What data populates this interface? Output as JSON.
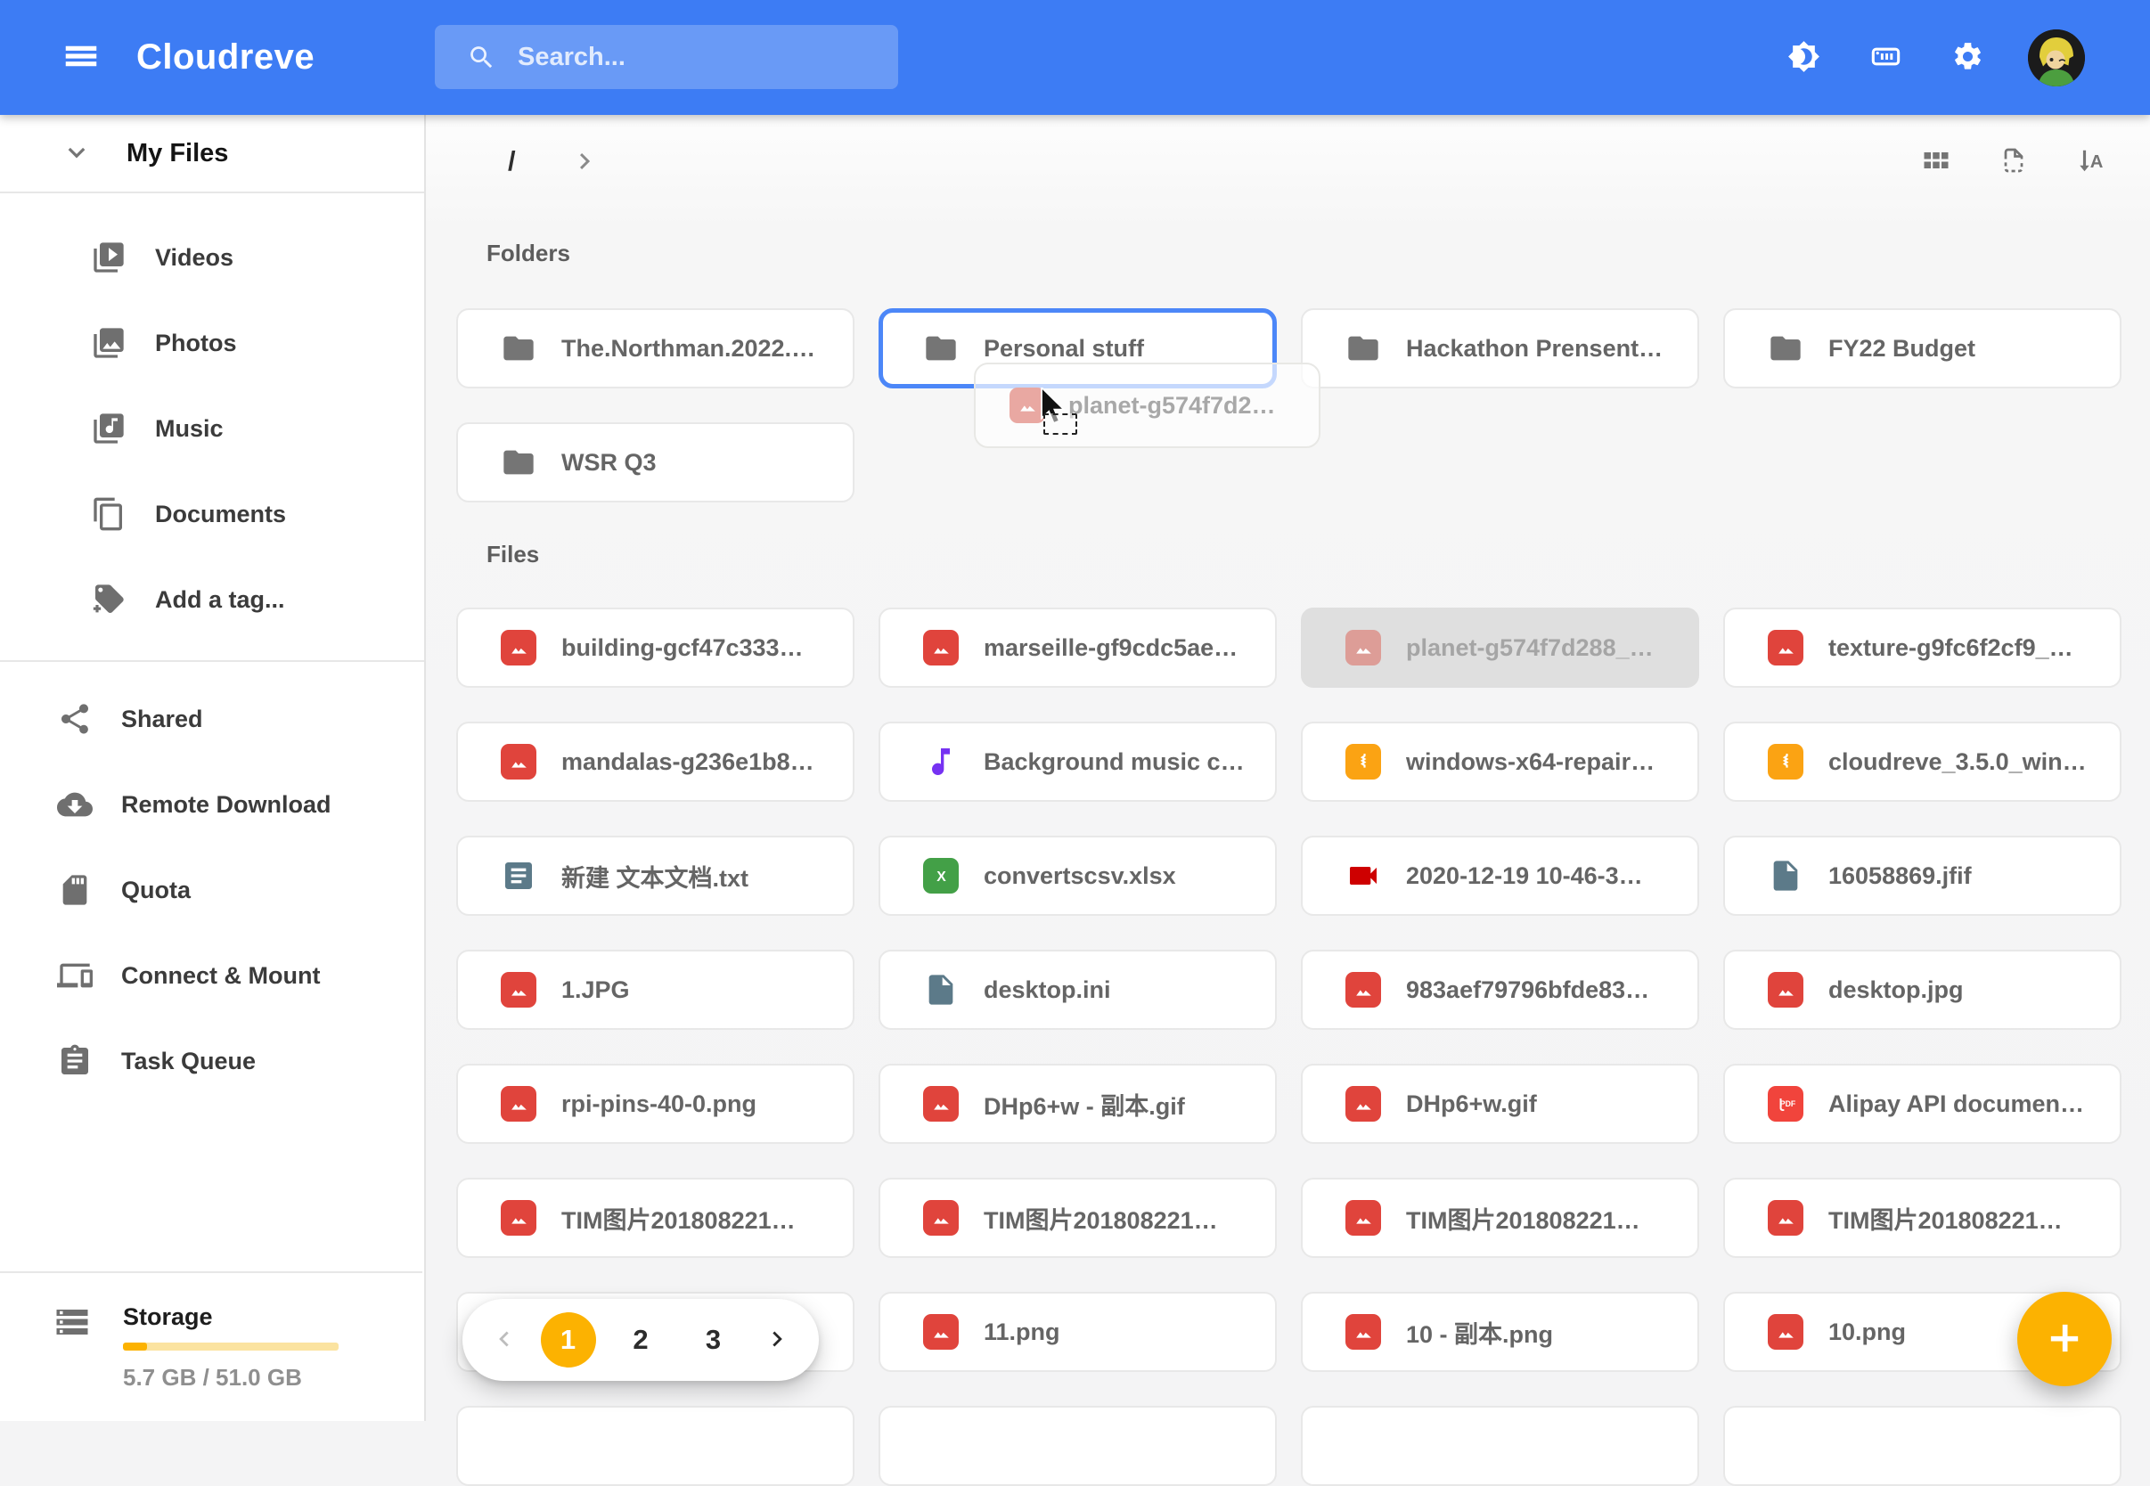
{
  "app": {
    "title": "Cloudreve"
  },
  "header": {
    "search_placeholder": "Search...",
    "icons": [
      "menu-icon",
      "search-icon",
      "dark-mode-icon",
      "nas-devices-icon",
      "settings-gear-icon",
      "user-avatar"
    ]
  },
  "sidebar": {
    "my_files_label": "My Files",
    "library_items": [
      {
        "label": "Videos",
        "icon": "video-library"
      },
      {
        "label": "Photos",
        "icon": "photo-library"
      },
      {
        "label": "Music",
        "icon": "music-library"
      },
      {
        "label": "Documents",
        "icon": "documents"
      },
      {
        "label": "Add a tag...",
        "icon": "tag-plus"
      }
    ],
    "nav_items": [
      {
        "label": "Shared",
        "icon": "share"
      },
      {
        "label": "Remote Download",
        "icon": "cloud-download"
      },
      {
        "label": "Quota",
        "icon": "sd-card"
      },
      {
        "label": "Connect & Mount",
        "icon": "devices"
      },
      {
        "label": "Task Queue",
        "icon": "clipboard"
      }
    ],
    "storage": {
      "label": "Storage",
      "usage": "5.7 GB / 51.0 GB",
      "percent": 11
    }
  },
  "content": {
    "breadcrumb": {
      "root": "/"
    },
    "toolbar_icons": [
      "grid-view-icon",
      "page-style-icon",
      "sort-alpha-icon"
    ],
    "folders_label": "Folders",
    "files_label": "Files",
    "folders": [
      {
        "name": "The.Northman.2022.…",
        "icon": "folder"
      },
      {
        "name": "Personal stuff",
        "icon": "folder",
        "state": "drop-target"
      },
      {
        "name": "Hackathon Prensent…",
        "icon": "folder"
      },
      {
        "name": "FY22 Budget",
        "icon": "folder"
      },
      {
        "name": "WSR Q3",
        "icon": "folder"
      }
    ],
    "files": [
      {
        "name": "building-gcf47c333…",
        "icon": "image"
      },
      {
        "name": "marseille-gf9cdc5ae…",
        "icon": "image"
      },
      {
        "name": "planet-g574f7d288_…",
        "icon": "image",
        "state": "drag-source"
      },
      {
        "name": "texture-g9fc6f2cf9_…",
        "icon": "image"
      },
      {
        "name": "mandalas-g236e1b8…",
        "icon": "image"
      },
      {
        "name": "Background music c…",
        "icon": "music"
      },
      {
        "name": "windows-x64-repair…",
        "icon": "zip"
      },
      {
        "name": "cloudreve_3.5.0_win…",
        "icon": "zip"
      },
      {
        "name": "新建 文本文档.txt",
        "icon": "txt"
      },
      {
        "name": "convertscsv.xlsx",
        "icon": "excel"
      },
      {
        "name": "2020-12-19 10-46-3…",
        "icon": "video"
      },
      {
        "name": "16058869.jfif",
        "icon": "file"
      },
      {
        "name": "1.JPG",
        "icon": "image"
      },
      {
        "name": "desktop.ini",
        "icon": "file"
      },
      {
        "name": "983aef79796bfde83…",
        "icon": "image"
      },
      {
        "name": "desktop.jpg",
        "icon": "image"
      },
      {
        "name": "rpi-pins-40-0.png",
        "icon": "image"
      },
      {
        "name": "DHp6+w - 副本.gif",
        "icon": "image"
      },
      {
        "name": "DHp6+w.gif",
        "icon": "image"
      },
      {
        "name": "Alipay API documen…",
        "icon": "pdf"
      },
      {
        "name": "TIM图片201808221…",
        "icon": "image"
      },
      {
        "name": "TIM图片201808221…",
        "icon": "image"
      },
      {
        "name": "TIM图片201808221…",
        "icon": "image"
      },
      {
        "name": "TIM图片201808221…",
        "icon": "image"
      },
      {
        "name": ""
      },
      {
        "name": "11.png",
        "icon": "image"
      },
      {
        "name": "10 - 副本.png",
        "icon": "image"
      },
      {
        "name": "10.png",
        "icon": "image"
      },
      {
        "name": ""
      },
      {
        "name": ""
      },
      {
        "name": ""
      },
      {
        "name": ""
      }
    ],
    "drag_ghost": {
      "name": "planet-g574f7d2…",
      "icon": "image"
    },
    "pagination": {
      "pages": [
        {
          "label": "1",
          "state": "active"
        },
        {
          "label": "2"
        },
        {
          "label": "3"
        }
      ]
    }
  },
  "colors": {
    "appbar_blue": "#3D7CF4",
    "accent_amber": "#FCB201",
    "drop_target_blue": "#4C87F8",
    "image_red": "#E0443C",
    "zip_amber": "#FBA313",
    "excel_green": "#43A047",
    "video_red": "#CE0000",
    "music_purple": "#7632F2",
    "file_bluegray": "#5C7A89",
    "pdf_red": "#F1443C"
  }
}
